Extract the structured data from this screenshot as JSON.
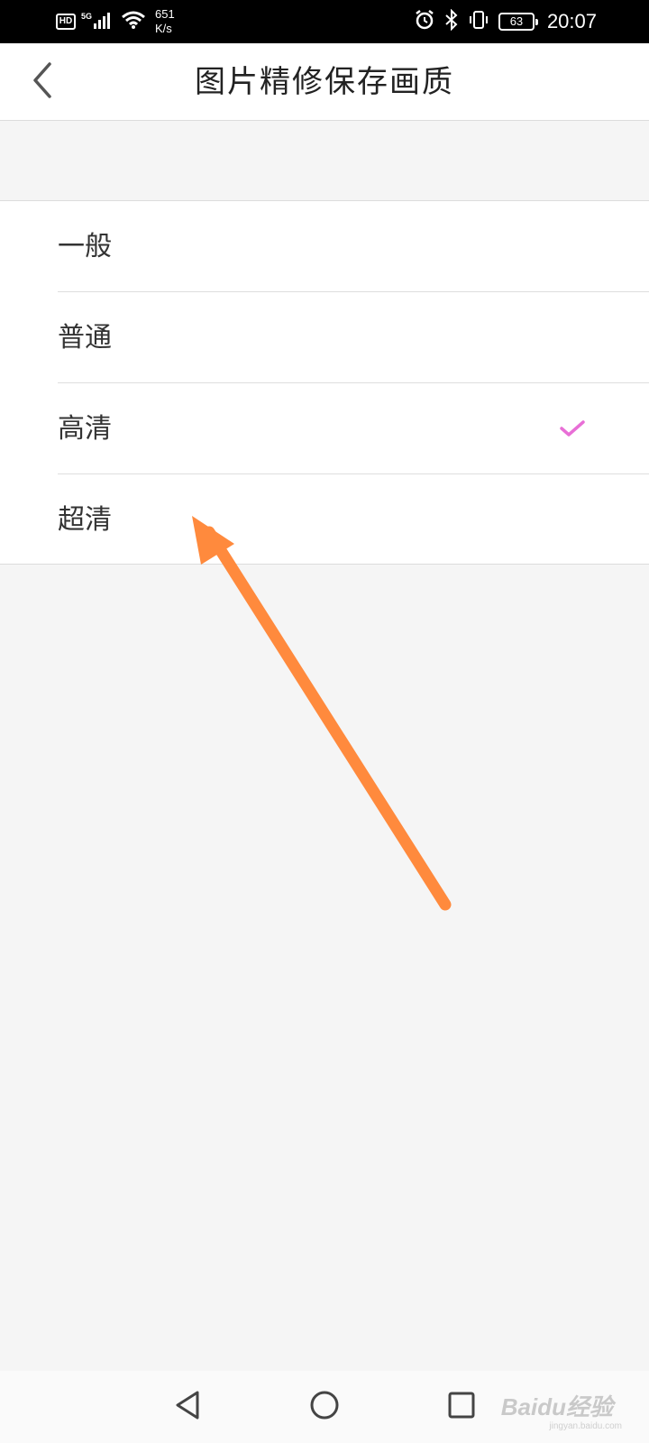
{
  "status_bar": {
    "hd_badge": "HD",
    "network": "5G",
    "speed_value": "651",
    "speed_unit": "K/s",
    "battery": "63",
    "time": "20:07"
  },
  "header": {
    "title": "图片精修保存画质",
    "back_icon": "chevron-left-icon"
  },
  "options": {
    "items": [
      {
        "label": "一般",
        "selected": false
      },
      {
        "label": "普通",
        "selected": false
      },
      {
        "label": "高清",
        "selected": true
      },
      {
        "label": "超清",
        "selected": false
      }
    ],
    "check_icon": "checkmark-icon",
    "check_color": "#e86fd6"
  },
  "annotation": {
    "arrow_color": "#ff8a3d"
  },
  "nav_bar": {
    "back_icon": "triangle-back-icon",
    "home_icon": "circle-home-icon",
    "recent_icon": "square-recent-icon"
  },
  "watermark": {
    "brand": "Baidu经验",
    "url": "jingyan.baidu.com"
  }
}
